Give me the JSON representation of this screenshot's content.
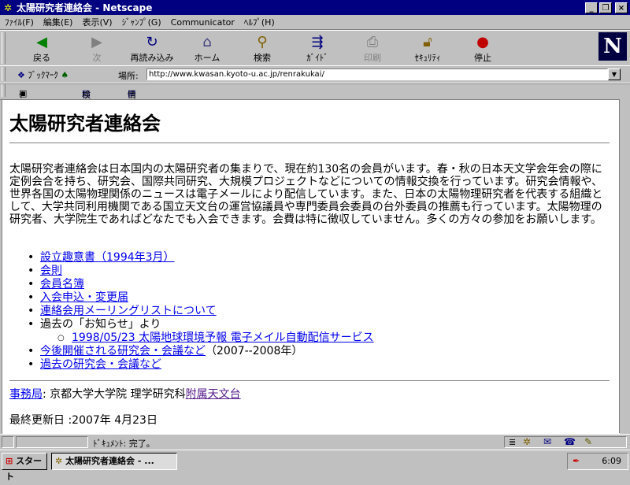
{
  "window": {
    "title": "太陽研究者連絡会 - Netscape",
    "min": "_",
    "max": "❐",
    "close": "×"
  },
  "menu": [
    "ﾌｧｲﾙ(F)",
    "編集(E)",
    "表示(V)",
    "ｼﾞｬﾝﾌﾟ(G)",
    "Communicator",
    "ﾍﾙﾌﾟ(H)"
  ],
  "toolbar": {
    "back": "戻る",
    "forward": "次",
    "reload": "再読み込み",
    "home": "ホーム",
    "search": "検索",
    "guide": "ｶﾞｲﾄﾞ",
    "print": "印刷",
    "security": "ｾｷｭﾘﾃｨ",
    "stop": "停止"
  },
  "location": {
    "bookmarks": "ﾌﾞｯｸﾏｰｸ",
    "label": "場所:",
    "url": "http://www.kwasan.kyoto-u.ac.jp/renrakukai/"
  },
  "personal": {
    "internet": "ｲﾝﾀｰﾈｯﾄ",
    "search": "検索",
    "info": "情報"
  },
  "page": {
    "heading": "太陽研究者連絡会",
    "intro": "太陽研究者連絡会は日本国内の太陽研究者の集まりで、現在約130名の会員がいます。春・秋の日本天文学会年会の際に定例会合を持ち、研究会、国際共同研究、大規模プロジェクトなどについての情報交換を行っています。研究会情報や、世界各国の太陽物理関係のニュースは電子メールにより配信しています。また、日本の太陽物理研究者を代表する組織として、大学共同利用機関である国立天文台の運営協議員や専門委員会委員の台外委員の推薦も行っています。太陽物理の研究者、大学院生であればどなたでも入会できます。会費は特に徴収していません。多くの方々の参加をお願いします。",
    "links": {
      "prospectus": "設立趣意書（1994年3月）",
      "rules": "会則",
      "members": "会員名簿",
      "join": "入会申込・変更届",
      "mailing": "連絡会用メーリングリストについて",
      "past_notice": "過去の「お知らせ」より",
      "forecast": "1998/05/23 太陽地球環境予報 電子メイル自動配信サービス",
      "upcoming": "今後開催される研究会・会議など",
      "upcoming_years": "（2007--2008年）",
      "past_meetings": "過去の研究会・会議など"
    },
    "office_link": "事務局",
    "office_text": ": 京都大学大学院 理学研究科",
    "office_link2": "附属天文台",
    "updated": "最終更新日 :2007年 4月23日"
  },
  "status": {
    "text": "ﾄﾞｷｭﾒﾝﾄ: 完了。"
  },
  "taskbar": {
    "start": "スタート",
    "task": "太陽研究者連絡会 - ...",
    "clock": "6:09"
  }
}
